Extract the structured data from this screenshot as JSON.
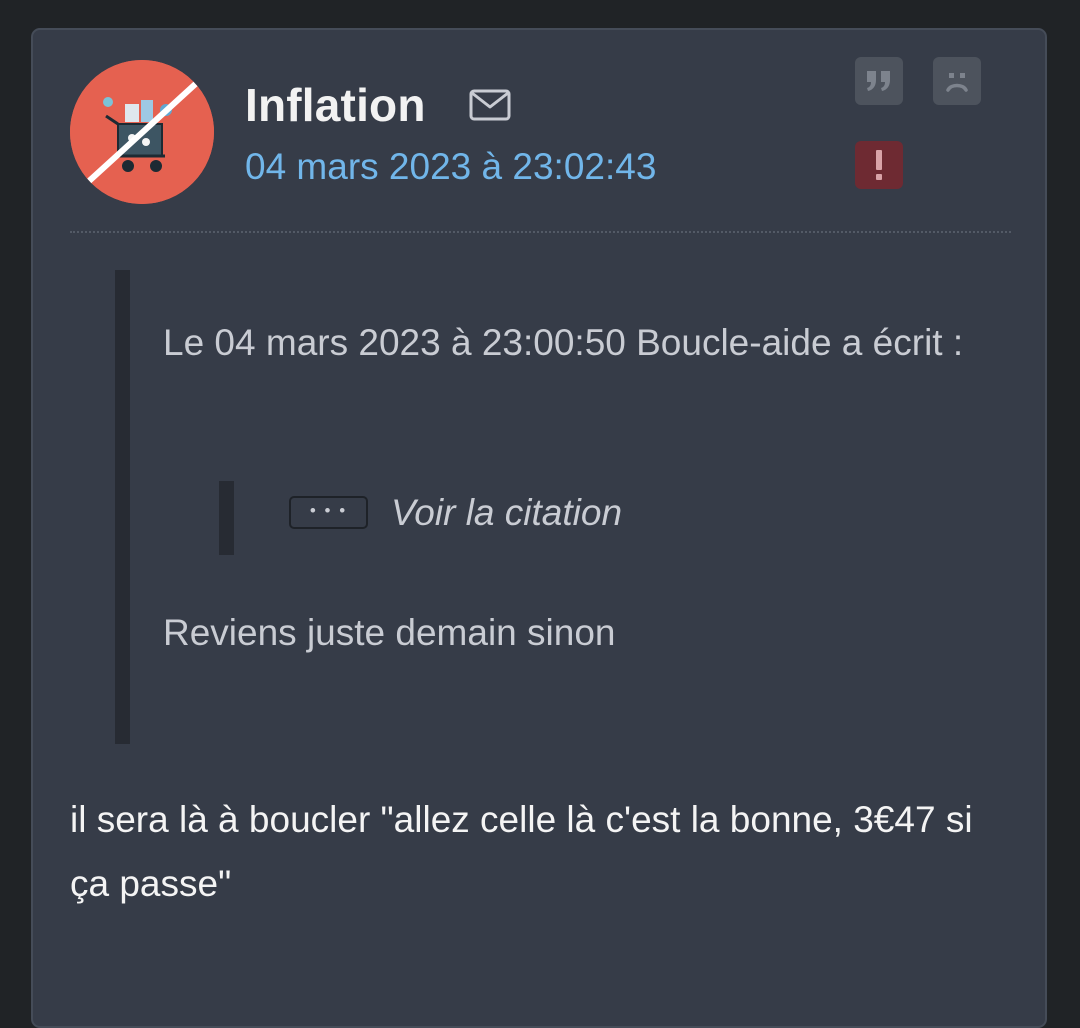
{
  "post": {
    "author": "Inflation",
    "date": "04 mars 2023 à 23:02:43",
    "icons": {
      "avatar": "avatar-shopping-cart-crossed",
      "mail": "envelope-icon",
      "quote": "quote-icon",
      "mp": "sad-face-icon",
      "report": "exclamation-icon"
    },
    "colors": {
      "card_bg": "#363c48",
      "date_link": "#71b6ea",
      "report_bg": "#6e2a32",
      "avatar_bg": "#e56150"
    },
    "quote": {
      "header": "Le 04 mars 2023 à 23:00:50 Boucle-aide a écrit :",
      "nested_ellipsis": "• • •",
      "nested_label": "Voir la citation",
      "body": "Reviens juste demain sinon"
    },
    "message": "il sera là à boucler \"allez celle là c'est la bonne, 3€47 si ça passe\""
  }
}
